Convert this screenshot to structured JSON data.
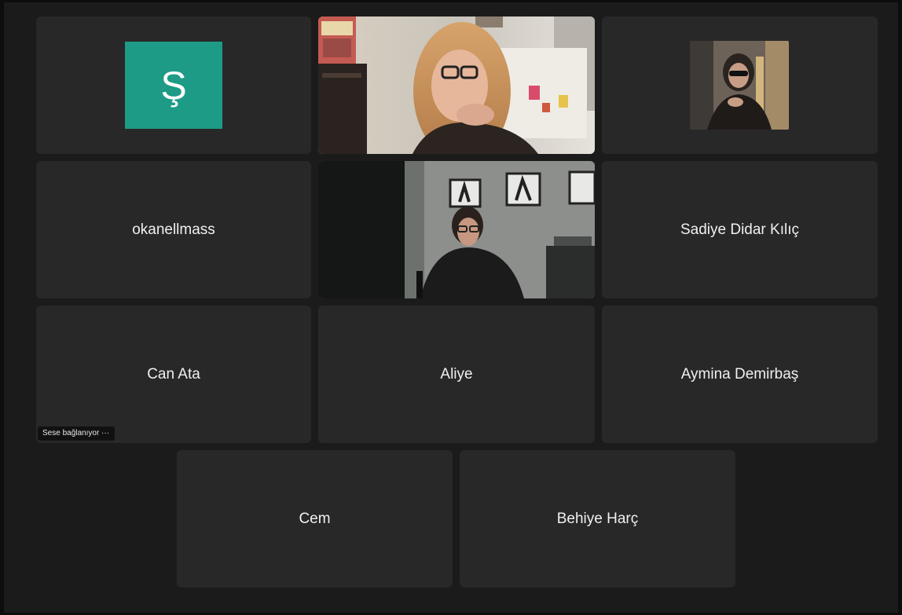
{
  "meeting": {
    "accent_avatar_color": "#1e9b86",
    "active_speaker_border": "#3fbf5b",
    "tiles": [
      {
        "kind": "avatar",
        "initial": "Ş"
      },
      {
        "kind": "video",
        "description_icon": "video-feed"
      },
      {
        "kind": "photo",
        "description_icon": "profile-photo"
      },
      {
        "kind": "name",
        "name": "okanellmass"
      },
      {
        "kind": "video-active",
        "description_icon": "video-feed"
      },
      {
        "kind": "name",
        "name": "Sadiye Didar Kılıç"
      },
      {
        "kind": "name",
        "name": "Can Ata",
        "status": "Sese bağlanıyor ···"
      },
      {
        "kind": "name",
        "name": "Aliye"
      },
      {
        "kind": "name",
        "name": "Aymina Demirbaş"
      },
      {
        "kind": "name",
        "name": "Cem"
      },
      {
        "kind": "name",
        "name": "Behiye Harç"
      }
    ]
  }
}
